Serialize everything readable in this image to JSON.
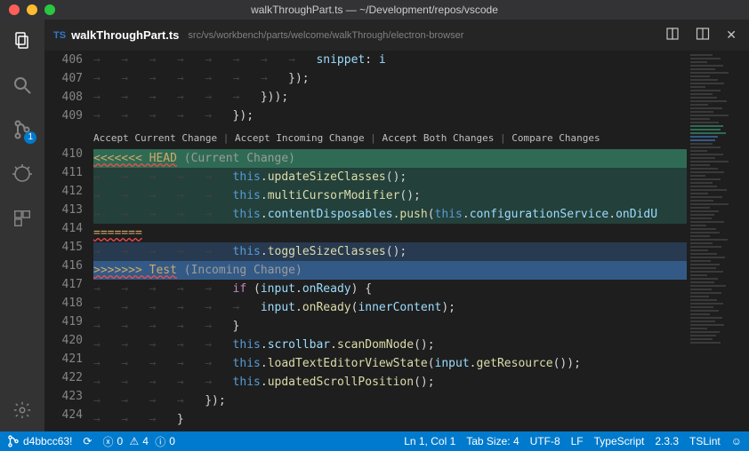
{
  "window": {
    "title": "walkThroughPart.ts — ~/Development/repos/vscode"
  },
  "tab": {
    "icon_label": "TS",
    "filename": "walkThroughPart.ts",
    "path": "src/vs/workbench/parts/welcome/walkThrough/electron-browser"
  },
  "activity_badge": "1",
  "codelens": {
    "accept_current": "Accept Current Change",
    "accept_incoming": "Accept Incoming Change",
    "accept_both": "Accept Both Changes",
    "compare": "Compare Changes",
    "sep": " | "
  },
  "conflict": {
    "head_marker": "<<<<<<< HEAD",
    "head_label": " (Current Change)",
    "divider": "=======",
    "tail_marker": ">>>>>>> Test",
    "tail_label": " (Incoming Change)"
  },
  "lines": {
    "406": "                                snippet: i",
    "407": "                            });",
    "408": "                        }));",
    "409": "                    });",
    "411": "                    this.updateSizeClasses();",
    "412": "                    this.multiCursorModifier();",
    "413": "                    this.contentDisposables.push(this.configurationService.onDidU",
    "415": "                    this.toggleSizeClasses();",
    "417": "                    if (input.onReady) {",
    "418": "                        input.onReady(innerContent);",
    "419": "                    }",
    "420": "                    this.scrollbar.scanDomNode();",
    "421": "                    this.loadTextEditorViewState(input.getResource());",
    "422": "                    this.updatedScrollPosition();",
    "423": "                });",
    "424": "            }"
  },
  "nums": [
    "406",
    "407",
    "408",
    "409",
    "410",
    "411",
    "412",
    "413",
    "414",
    "415",
    "416",
    "417",
    "418",
    "419",
    "420",
    "421",
    "422",
    "423",
    "424"
  ],
  "status": {
    "branch": "d4bbcc63!",
    "errors": "0",
    "warnings": "4",
    "info": "0",
    "position": "Ln 1, Col 1",
    "tabsize": "Tab Size: 4",
    "encoding": "UTF-8",
    "eol": "LF",
    "language": "TypeScript",
    "ts_version": "2.3.3",
    "lint": "TSLint"
  }
}
